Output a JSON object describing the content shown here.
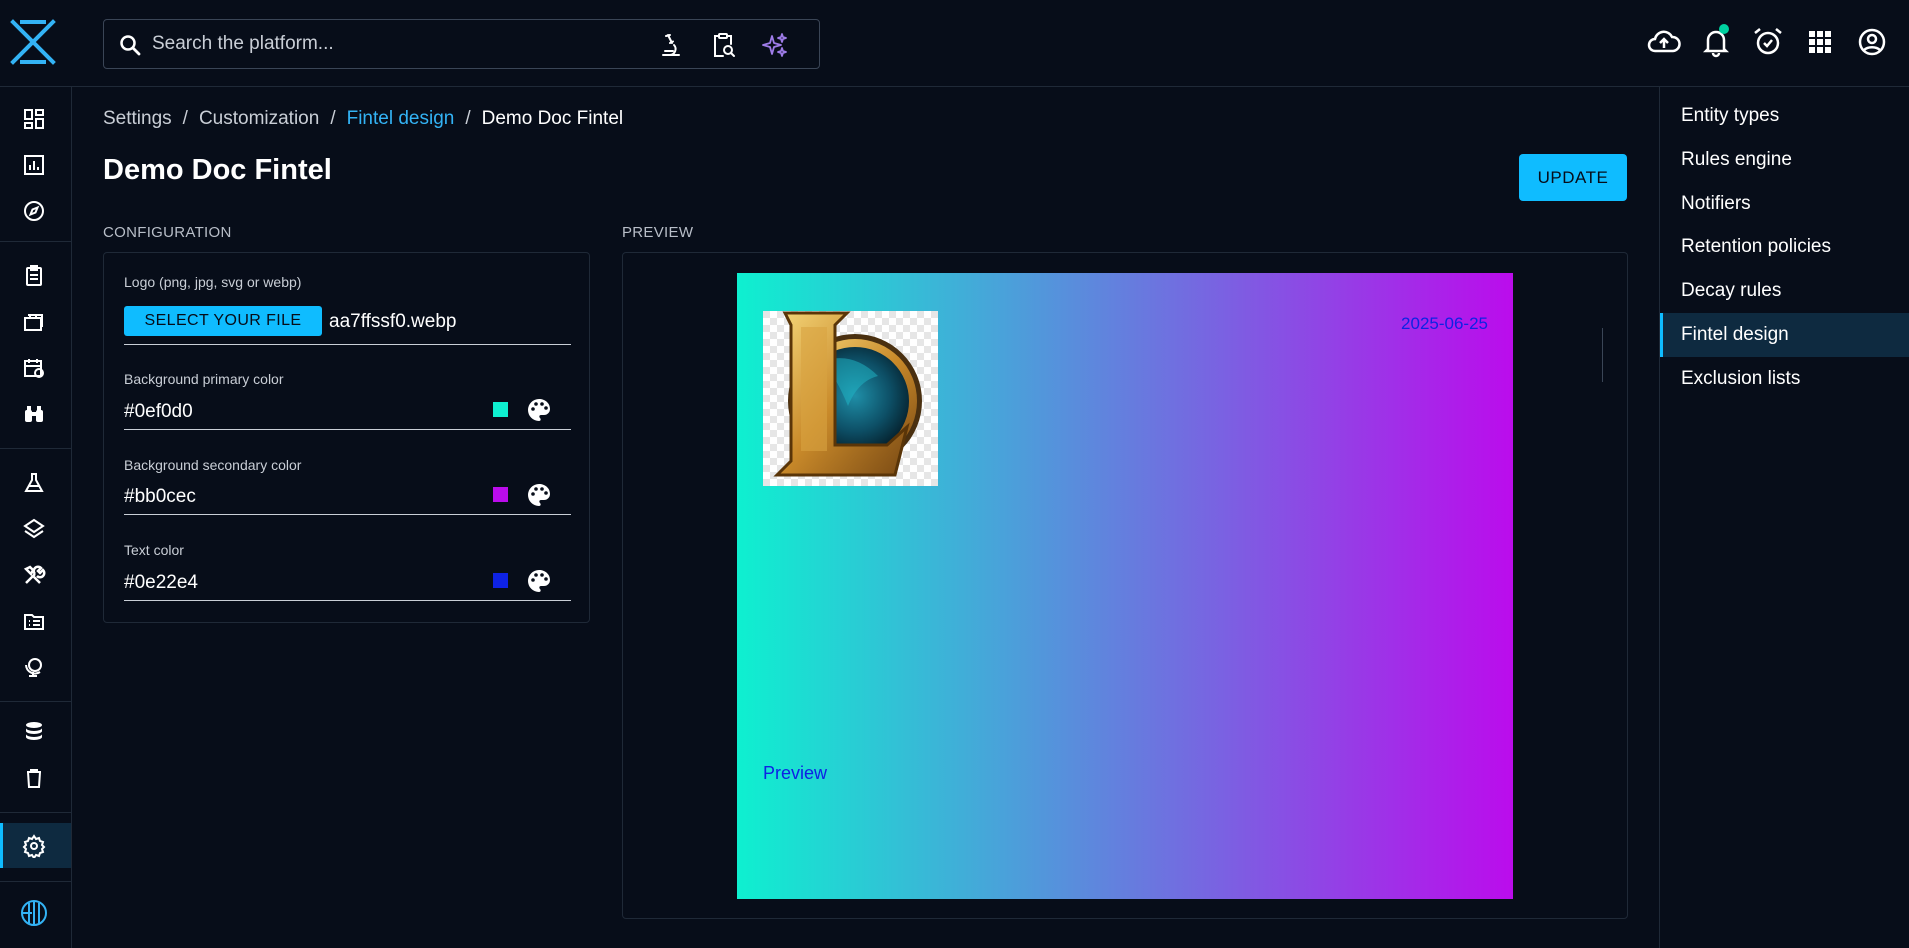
{
  "search": {
    "placeholder": "Search the platform..."
  },
  "breadcrumb": [
    {
      "label": "Settings"
    },
    {
      "label": "Customization"
    },
    {
      "label": "Fintel design"
    },
    {
      "label": "Demo Doc Fintel"
    }
  ],
  "page": {
    "title": "Demo Doc Fintel",
    "update_label": "UPDATE"
  },
  "configuration": {
    "section_label": "CONFIGURATION",
    "logo": {
      "label": "Logo (png, jpg, svg or webp)",
      "button_label": "SELECT YOUR FILE",
      "file_name": "aa7ffssf0.webp"
    },
    "primary": {
      "label": "Background primary color",
      "value": "#0ef0d0",
      "swatch": "#0ef0d0"
    },
    "secondary": {
      "label": "Background secondary color",
      "value": "#bb0cec",
      "swatch": "#bb0cec"
    },
    "text": {
      "label": "Text color",
      "value": "#0e22e4",
      "swatch": "#0e22e4"
    }
  },
  "preview": {
    "section_label": "PREVIEW",
    "date": "2025-06-25",
    "text": "Preview"
  },
  "right_nav": {
    "items": [
      {
        "label": "Entity types"
      },
      {
        "label": "Rules engine"
      },
      {
        "label": "Notifiers"
      },
      {
        "label": "Retention policies"
      },
      {
        "label": "Decay rules"
      },
      {
        "label": "Fintel design",
        "active": true
      },
      {
        "label": "Exclusion lists"
      }
    ]
  },
  "colors": {
    "accent": "#0fbcff",
    "background": "#070d19",
    "active_bg": "#0e2a40",
    "link": "#33b3f5",
    "notification_dot": "#00d1a0"
  },
  "icons": {
    "top": [
      "cloud-upload-icon",
      "bell-icon",
      "alarm-icon",
      "apps-grid-icon",
      "account-icon"
    ],
    "left_nav": [
      "dashboard-icon",
      "analytics-icon",
      "compass-icon",
      "clipboard-icon",
      "cases-icon",
      "events-icon",
      "observations-icon",
      "techniques-icon",
      "layers-icon",
      "tools-icon",
      "data-folder-icon",
      "globe-icon",
      "database-icon",
      "trash-icon",
      "settings-icon",
      "filigran-icon"
    ]
  }
}
